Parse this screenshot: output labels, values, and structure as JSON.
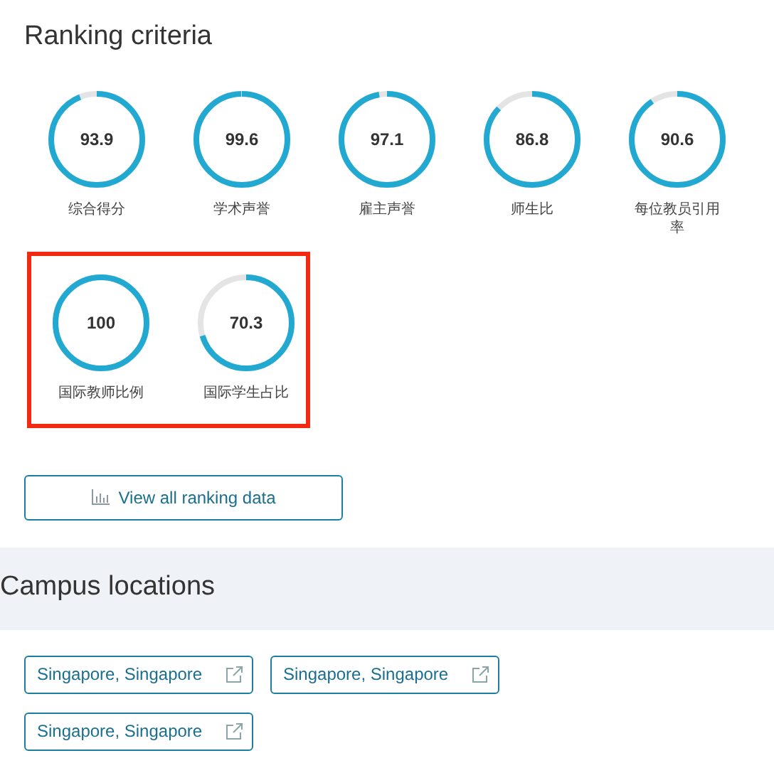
{
  "ranking": {
    "title": "Ranking criteria",
    "criteria": [
      {
        "value": "93.9",
        "label": "综合得分"
      },
      {
        "value": "99.6",
        "label": "学术声誉"
      },
      {
        "value": "97.1",
        "label": "雇主声誉"
      },
      {
        "value": "86.8",
        "label": "师生比"
      },
      {
        "value": "90.6",
        "label": "每位教员引用率"
      }
    ],
    "highlighted_criteria": [
      {
        "value": "100",
        "label": "国际教师比例"
      },
      {
        "value": "70.3",
        "label": "国际学生占比"
      }
    ],
    "button": "View all ranking data"
  },
  "campus": {
    "title": "Campus locations",
    "locations": [
      "Singapore, Singapore",
      "Singapore, Singapore",
      "Singapore, Singapore"
    ]
  }
}
